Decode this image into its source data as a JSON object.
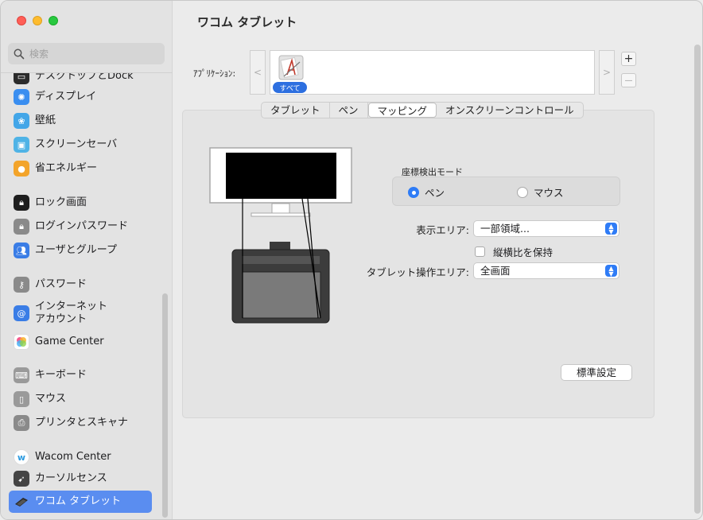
{
  "window": {
    "title": "ワコム タブレット"
  },
  "sidebar": {
    "search_placeholder": "検索",
    "items": [
      {
        "label": "デスクトップとDock",
        "icon": "dock-icon",
        "color": "#2b2b2b"
      },
      {
        "label": "ディスプレイ",
        "icon": "display-icon",
        "color": "#3a8ef0"
      },
      {
        "label": "壁紙",
        "icon": "wallpaper-icon",
        "color": "#43a6e8"
      },
      {
        "label": "スクリーンセーバ",
        "icon": "screensaver-icon",
        "color": "#4fb3e6"
      },
      {
        "label": "省エネルギー",
        "icon": "bulb-icon",
        "color": "#f3a42a"
      },
      {
        "label": "ロック画面",
        "icon": "lock-icon",
        "color": "#1e1e1e"
      },
      {
        "label": "ログインパスワード",
        "icon": "lock-icon",
        "color": "#8a8a8a"
      },
      {
        "label": "ユーザとグループ",
        "icon": "users-icon",
        "color": "#3a7de6"
      },
      {
        "label": "パスワード",
        "icon": "key-icon",
        "color": "#8a8a8a"
      },
      {
        "label": "インターネット\nアカウント",
        "icon": "at-icon",
        "color": "#3a7de6"
      },
      {
        "label": "Game Center",
        "icon": "game-center-icon",
        "color": "#ffffff"
      },
      {
        "label": "キーボード",
        "icon": "keyboard-icon",
        "color": "#9a9a9a"
      },
      {
        "label": "マウス",
        "icon": "mouse-icon",
        "color": "#9a9a9a"
      },
      {
        "label": "プリンタとスキャナ",
        "icon": "printer-icon",
        "color": "#8a8a8a"
      },
      {
        "label": "Wacom Center",
        "icon": "wacom-icon",
        "color": "#ffffff"
      },
      {
        "label": "カーソルセンス",
        "icon": "cursor-sense-icon",
        "color": "#444444"
      },
      {
        "label": "ワコム タブレット",
        "icon": "tablet-icon",
        "color": "#5a8df0",
        "active": true
      }
    ]
  },
  "apps": {
    "label": "ｱﾌﾟﾘｹｰｼｮﾝ:",
    "prev": "<",
    "next": ">",
    "all_label": "すべて",
    "add": "+",
    "remove": "—"
  },
  "tabs": [
    {
      "label": "タブレット",
      "selected": false
    },
    {
      "label": "ペン",
      "selected": false
    },
    {
      "label": "マッピング",
      "selected": true
    },
    {
      "label": "オンスクリーンコントロール",
      "selected": false
    }
  ],
  "mapping": {
    "coord_mode_label": "座標検出モード",
    "radio_pen": "ペン",
    "radio_mouse": "マウス",
    "selected_mode": "pen",
    "display_area_label": "表示エリア:",
    "display_area_value": "一部領域...",
    "keep_ratio_label": "縦横比を保持",
    "keep_ratio_checked": false,
    "tablet_area_label": "タブレット操作エリア:",
    "tablet_area_value": "全画面",
    "default_button": "標準設定"
  }
}
